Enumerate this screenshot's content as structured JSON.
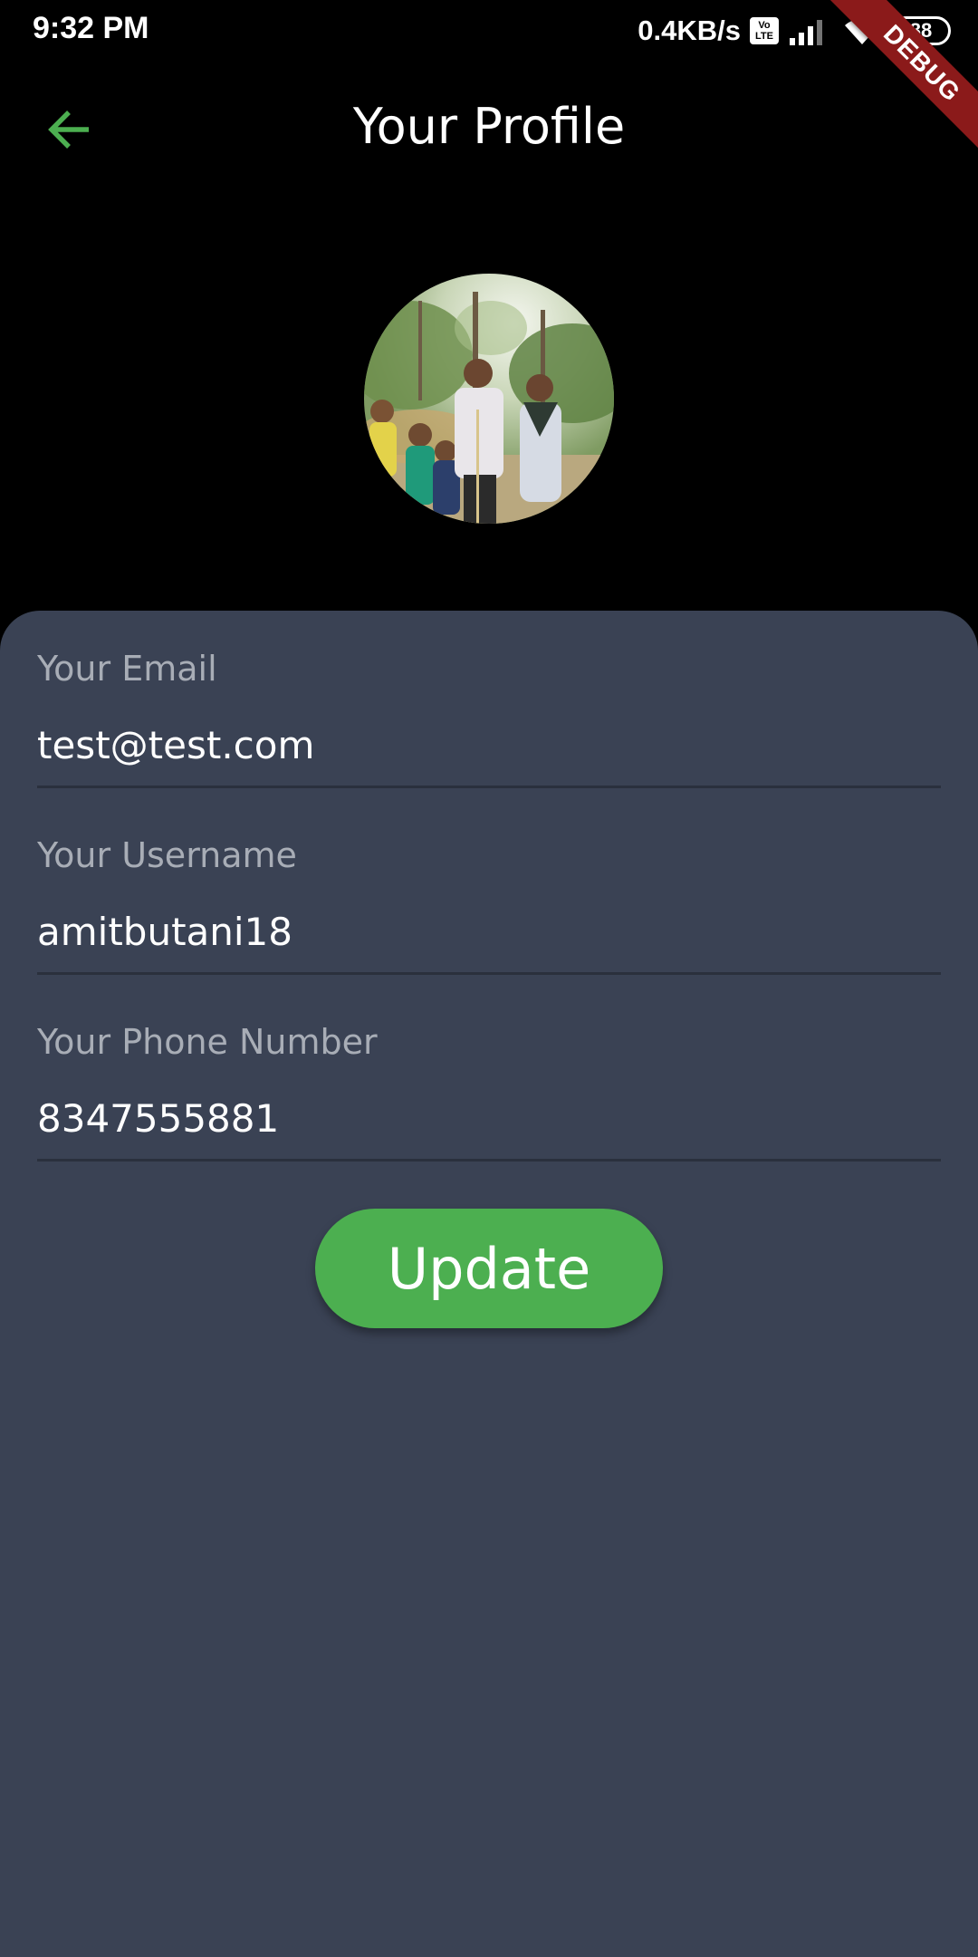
{
  "status_bar": {
    "time": "9:32 PM",
    "net_speed": "0.4KB/s",
    "volte_top": "Vo",
    "volte_bottom": "LTE",
    "battery": "88",
    "icons": [
      "volte-icon",
      "signal-icon",
      "wifi-icon",
      "battery-icon"
    ]
  },
  "debug_banner": "DEBUG",
  "app_bar": {
    "back_icon": "arrow-left-icon",
    "title": "Your Profile"
  },
  "profile": {
    "avatar": "family-photo"
  },
  "form": {
    "email": {
      "label": "Your Email",
      "value": "test@test.com"
    },
    "username": {
      "label": "Your Username",
      "value": "amitbutani18"
    },
    "phone": {
      "label": "Your Phone Number",
      "value": "8347555881"
    },
    "update_label": "Update"
  },
  "colors": {
    "background": "#000000",
    "panel": "#3a4254",
    "accent": "#4caf50",
    "label": "#a8adb6",
    "divider": "#2a303d",
    "debug": "#8b1a1a"
  }
}
